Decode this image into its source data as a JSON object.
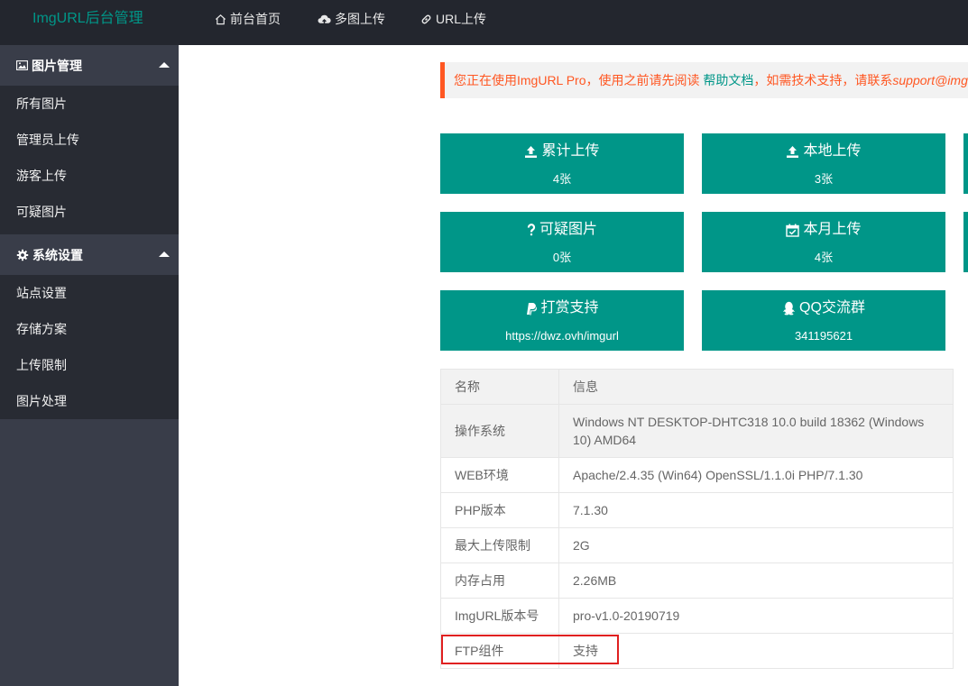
{
  "header": {
    "logo": "ImgURL后台管理",
    "nav": [
      {
        "label": "前台首页",
        "icon": "home-icon"
      },
      {
        "label": "多图上传",
        "icon": "cloud-upload-icon"
      },
      {
        "label": "URL上传",
        "icon": "link-icon"
      }
    ]
  },
  "sidebar": {
    "groups": [
      {
        "label": "图片管理",
        "icon": "image-icon",
        "items": [
          "所有图片",
          "管理员上传",
          "游客上传",
          "可疑图片"
        ]
      },
      {
        "label": "系统设置",
        "icon": "gear-icon",
        "items": [
          "站点设置",
          "存储方案",
          "上传限制",
          "图片处理"
        ]
      }
    ]
  },
  "notice": {
    "prefix": "您正在使用ImgURL Pro，使用之前请先阅读 ",
    "link": "帮助文档",
    "suffix": "，如需技术支持，请联系",
    "email": "support@img"
  },
  "cards": [
    {
      "title": "累计上传",
      "value": "4张",
      "icon": "upload-icon"
    },
    {
      "title": "本地上传",
      "value": "3张",
      "icon": "upload-icon"
    },
    {
      "title": "可疑图片",
      "value": "0张",
      "icon": "question-icon"
    },
    {
      "title": "本月上传",
      "value": "4张",
      "icon": "calendar-check-icon"
    },
    {
      "title": "打赏支持",
      "value": "https://dwz.ovh/imgurl",
      "icon": "paypal-icon"
    },
    {
      "title": "QQ交流群",
      "value": "341195621",
      "icon": "qq-icon"
    }
  ],
  "table": {
    "headers": [
      "名称",
      "信息"
    ],
    "rows": [
      {
        "name": "操作系统",
        "value": "Windows NT DESKTOP-DHTC318 10.0 build 18362 (Windows 10) AMD64"
      },
      {
        "name": "WEB环境",
        "value": "Apache/2.4.35 (Win64) OpenSSL/1.1.0i PHP/7.1.30"
      },
      {
        "name": "PHP版本",
        "value": "7.1.30"
      },
      {
        "name": "最大上传限制",
        "value": "2G"
      },
      {
        "name": "内存占用",
        "value": "2.26MB"
      },
      {
        "name": "ImgURL版本号",
        "value": "pro-v1.0-20190719"
      },
      {
        "name": "FTP组件",
        "value": "支持"
      }
    ]
  },
  "colors": {
    "brand": "#009688",
    "header_bg": "#23262e",
    "sidebar_bg": "#393d49",
    "sidebar_sub_bg": "#282b33",
    "notice_accent": "#ff5722",
    "highlight": "#e02020"
  }
}
